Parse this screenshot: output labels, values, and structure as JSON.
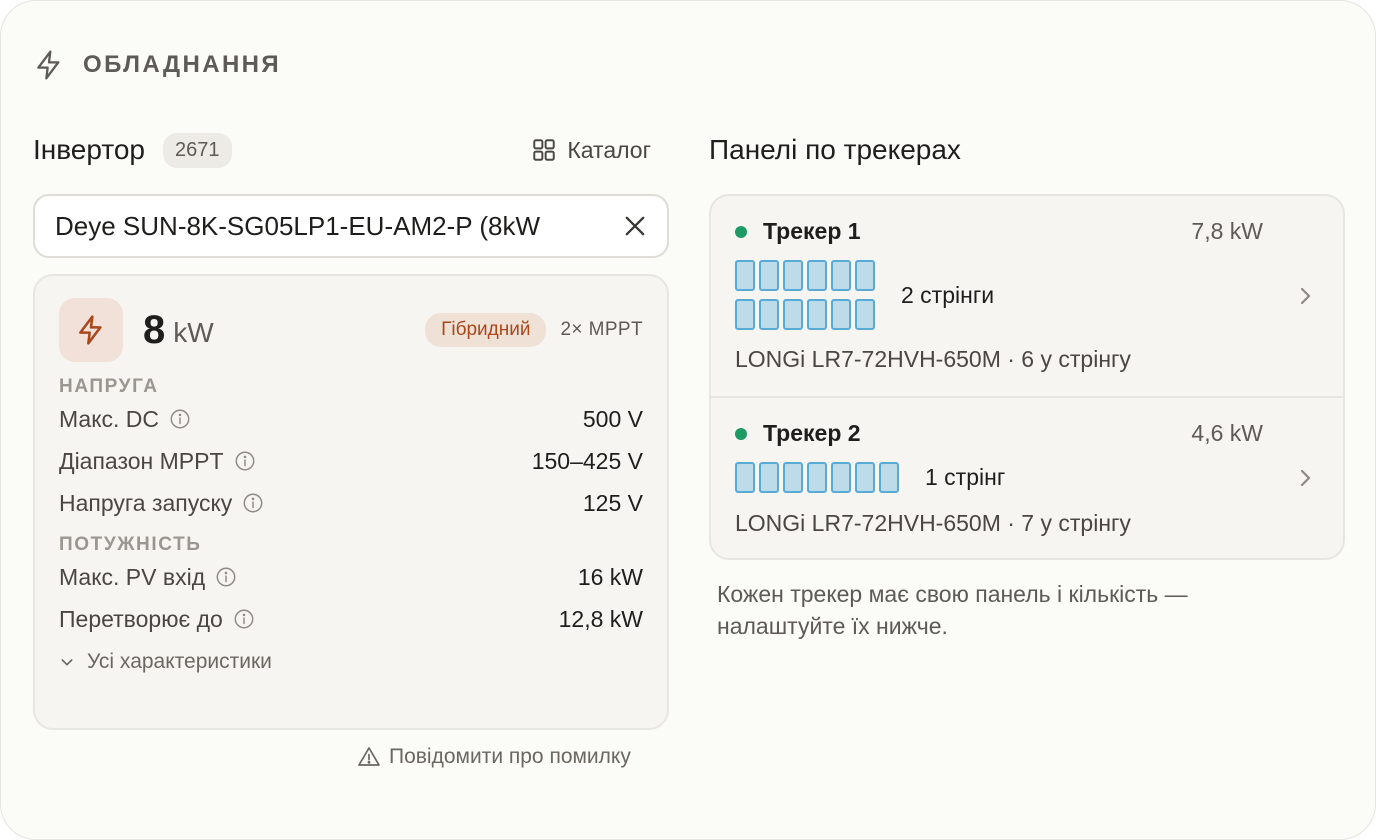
{
  "section": {
    "title": "ОБЛАДНАННЯ",
    "icon": "lightning-icon"
  },
  "inverter": {
    "title": "Інвертор",
    "count": "2671",
    "catalog_label": "Каталог",
    "search_value": "Deye SUN-8K-SG05LP1-EU-AM2-P (8kW",
    "power_value": "8",
    "power_unit": "kW",
    "type_badge": "Гібридний",
    "mppt": "2× MPPT",
    "voltage_group": "НАПРУГА",
    "voltage_rows": [
      {
        "label": "Макс. DC",
        "value": "500 V"
      },
      {
        "label": "Діапазон MPPT",
        "value": "150–425 V"
      },
      {
        "label": "Напруга запуску",
        "value": "125 V"
      }
    ],
    "power_group": "ПОТУЖНІСТЬ",
    "power_rows": [
      {
        "label": "Макс. PV вхід",
        "value": "16 kW"
      },
      {
        "label": "Перетворює до",
        "value": "12,8 kW"
      }
    ],
    "more_label": "Усі характеристики",
    "report_label": "Повідомити про помилку"
  },
  "panels": {
    "title": "Панелі по трекерах",
    "trackers": [
      {
        "name": "Трекер 1",
        "power": "7,8 kW",
        "strings_label": "2 стрінги",
        "strings": 2,
        "panels_per_string": 6,
        "model": "LONGi LR7-72HVH-650M · 6 у стрінгу"
      },
      {
        "name": "Трекер 2",
        "power": "4,6 kW",
        "strings_label": "1 стрінг",
        "strings": 1,
        "panels_per_string": 7,
        "model": "LONGi LR7-72HVH-650M · 7 у стрінгу"
      }
    ],
    "note": "Кожен трекер має свою панель і кількість — налаштуйте їх нижче."
  },
  "colors": {
    "accent": "#a9481c",
    "status_dot": "#1f9a64",
    "panel_fill": "#bedbea",
    "panel_border": "#5aaad6"
  }
}
